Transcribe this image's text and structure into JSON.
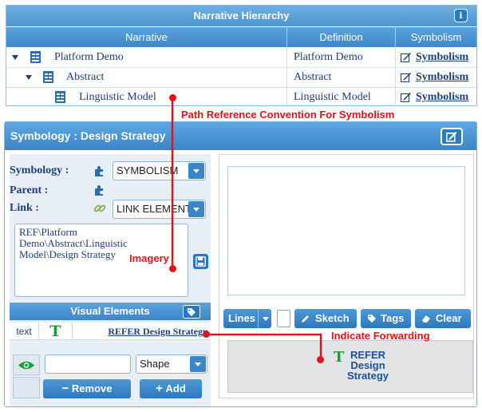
{
  "hierarchy": {
    "title": "Narrative Hierarchy",
    "columns": [
      "Narrative",
      "Definition",
      "Symbolism"
    ],
    "rows": [
      {
        "narrative": "Platform Demo",
        "definition": "Platform Demo",
        "symbolism": "Symbolism"
      },
      {
        "narrative": "Abstract",
        "definition": "Abstract",
        "symbolism": "Symbolism"
      },
      {
        "narrative": "Linguistic Model",
        "definition": "Linguistic Model",
        "symbolism": "Symbolism"
      }
    ]
  },
  "symbology": {
    "title": "Symbology : Design Strategy",
    "symbology_label": "Symbology :",
    "symbology_value": "SYMBOLISM",
    "parent_label": "Parent :",
    "link_label": "Link :",
    "link_value": "LINK ELEMENT",
    "path_text": "REF\\Platform Demo\\Abstract\\Linguistic Model\\Design Strategy",
    "visual_elements_title": "Visual Elements",
    "visual_row": {
      "type": "text",
      "glyph": "T",
      "label": "REFER Design Strategy"
    },
    "shape_value": "Shape",
    "remove_label": "Remove",
    "add_label": "Add"
  },
  "toolbar": {
    "lines": "Lines",
    "sketch": "Sketch",
    "tags": "Tags",
    "clear": "Clear"
  },
  "output": {
    "glyph": "T",
    "line1": "REFER",
    "line2": "Design",
    "line3": "Strategy"
  },
  "annotations": {
    "path_reference": "Path Reference Convention For Symbolism",
    "imagery": "Imagery",
    "indicate_forwarding": "Indicate Forwarding"
  },
  "colors": {
    "header_blue": "#4e94cf",
    "text_navy": "#1d3f77",
    "annotation_red": "#e0131b",
    "glyph_green": "#1a9c3a"
  }
}
